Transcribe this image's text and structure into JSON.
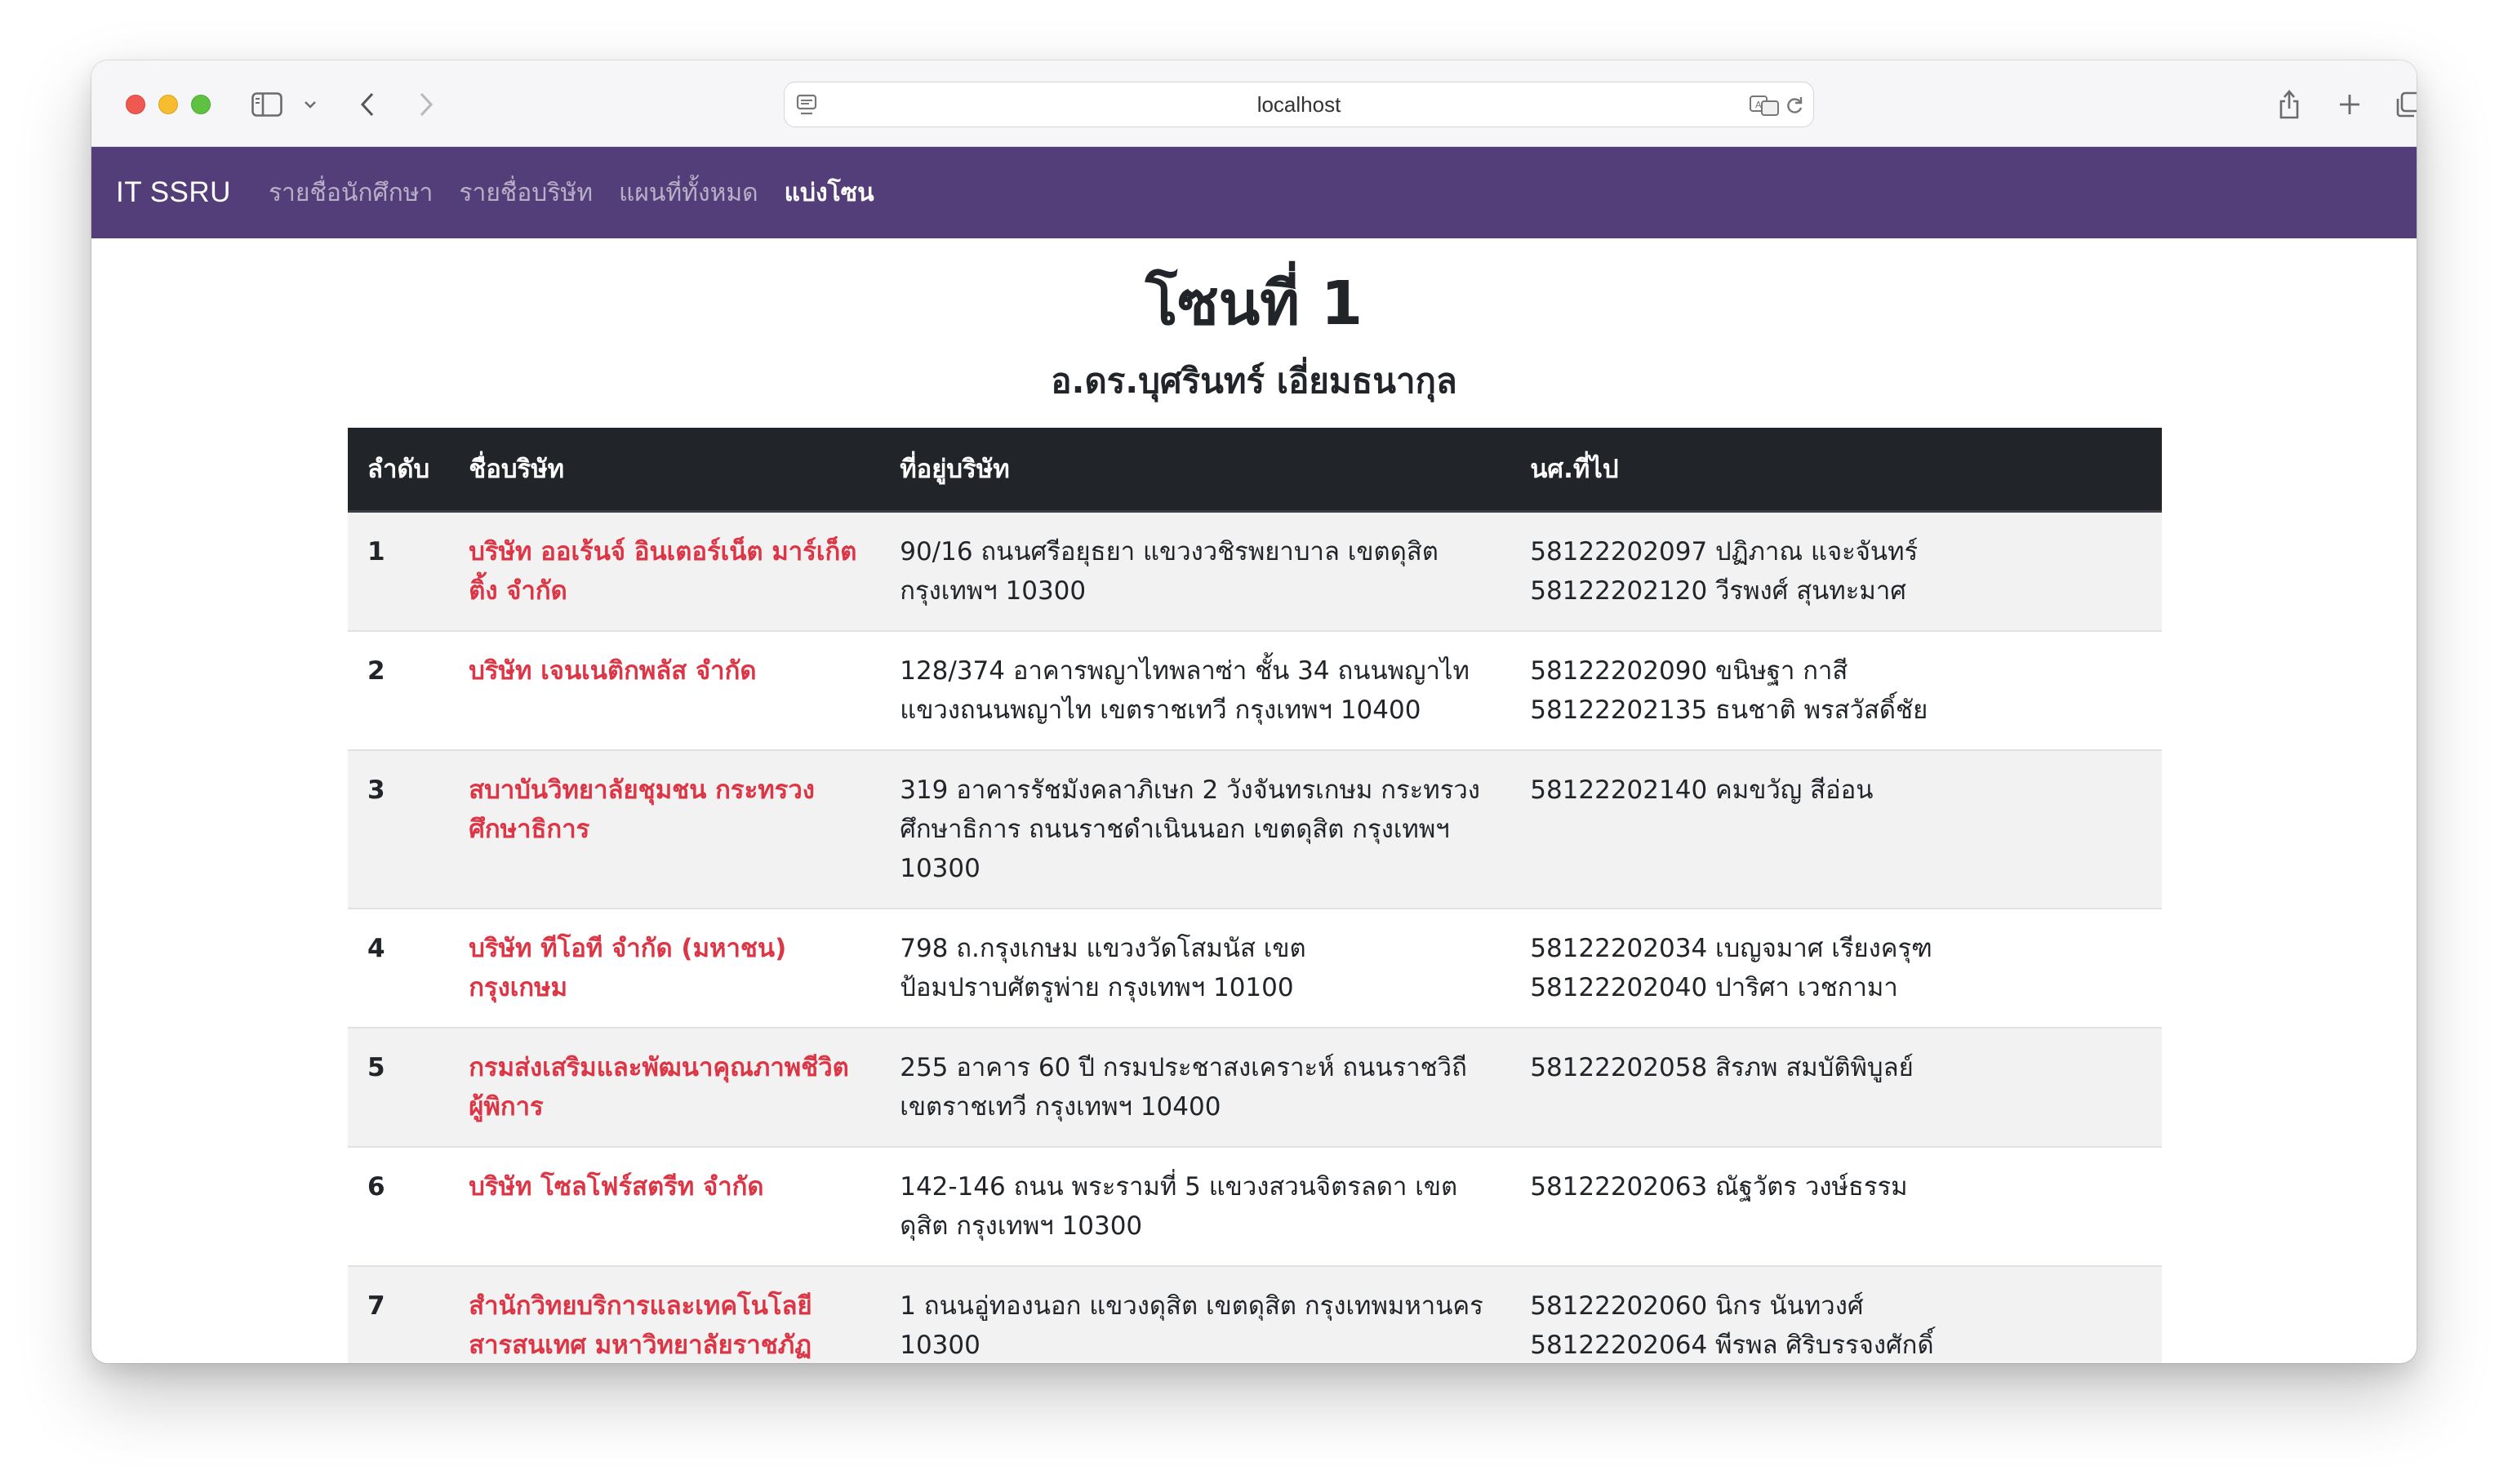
{
  "browser": {
    "url": "localhost"
  },
  "navbar": {
    "brand": "IT SSRU",
    "links": [
      {
        "label": "รายชื่อนักศึกษา",
        "active": false
      },
      {
        "label": "รายชื่อบริษัท",
        "active": false
      },
      {
        "label": "แผนที่ทั้งหมด",
        "active": false
      },
      {
        "label": "แบ่งโซน",
        "active": true
      }
    ]
  },
  "page": {
    "title": "โซนที่ 1",
    "teacher": "อ.ดร.บุศรินทร์ เอี่ยมธนากุล"
  },
  "table": {
    "headers": [
      "ลำดับ",
      "ชื่อบริษัท",
      "ที่อยู่บริษัท",
      "นศ.ที่ไป"
    ],
    "rows": [
      {
        "no": "1",
        "company": "บริษัท ออเร้นจ์ อินเตอร์เน็ต มาร์เก็ตติ้ง จำกัด",
        "address": "90/16 ถนนศรีอยุธยา แขวงวชิรพยาบาล เขตดุสิต กรุงเทพฯ 10300",
        "students": [
          "58122202097 ปฏิภาณ แจะจันทร์",
          "58122202120 วีรพงศ์ สุนทะมาศ"
        ]
      },
      {
        "no": "2",
        "company": "บริษัท เจนเนติกพลัส จำกัด",
        "address": "128/374 อาคารพญาไทพลาซ่า ชั้น 34 ถนนพญาไท แขวงถนนพญาไท เขตราชเทวี กรุงเทพฯ 10400",
        "students": [
          "58122202090 ขนิษฐา กาสี",
          "58122202135 ธนชาติ พรสวัสดิ์ชัย"
        ]
      },
      {
        "no": "3",
        "company": "สบาบันวิทยาลัยชุมชน กระทรวงศึกษาธิการ",
        "address": "319 อาคารรัชมังคลาภิเษก 2 วังจันทรเกษม กระทรวงศึกษาธิการ ถนนราชดำเนินนอก เขตดุสิต กรุงเทพฯ 10300",
        "students": [
          "58122202140 คมขวัญ สีอ่อน"
        ]
      },
      {
        "no": "4",
        "company": "บริษัท ทีโอที จำกัด (มหาชน) กรุงเกษม",
        "address": "798 ถ.กรุงเกษม แขวงวัดโสมนัส เขตป้อมปราบศัตรูพ่าย กรุงเทพฯ 10100",
        "students": [
          "58122202034 เบญจมาศ เรียงครุฑ",
          "58122202040 ปาริศา เวชกามา"
        ]
      },
      {
        "no": "5",
        "company": "กรมส่งเสริมและพัฒนาคุณภาพชีวิตผู้พิการ",
        "address": "255 อาคาร 60 ปี กรมประชาสงเคราะห์ ถนนราชวิถี เขตราชเทวี กรุงเทพฯ 10400",
        "students": [
          "58122202058 สิรภพ สมบัติพิบูลย์"
        ]
      },
      {
        "no": "6",
        "company": "บริษัท โซลโฟร์สตรีท จำกัด",
        "address": "142-146 ถนน พระรามที่ 5 แขวงสวนจิตรลดา เขตดุสิต กรุงเทพฯ 10300",
        "students": [
          "58122202063 ณัฐวัตร วงษ์ธรรม"
        ]
      },
      {
        "no": "7",
        "company": "สำนักวิทยบริการและเทคโนโลยีสารสนเทศ มหาวิทยาลัยราชภัฏ",
        "address": "1 ถนนอู่ทองนอก แขวงดุสิต เขตดุสิต กรุงเทพมหานคร 10300",
        "students": [
          "58122202060 นิกร นันทวงศ์",
          "58122202064 พีรพล ศิริบรรจงศักดิ์"
        ]
      }
    ]
  }
}
